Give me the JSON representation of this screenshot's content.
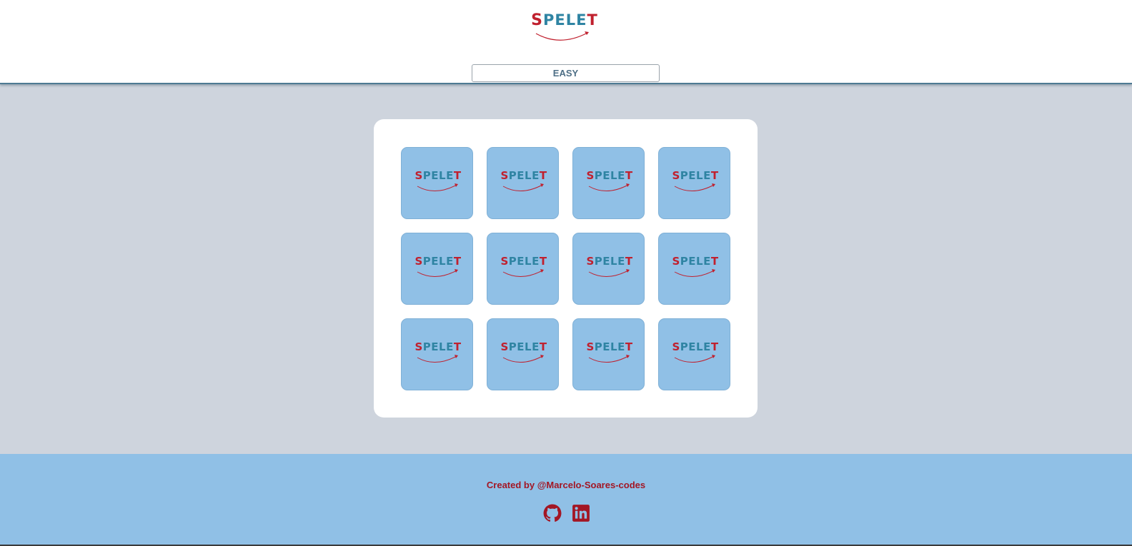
{
  "header": {
    "logo": {
      "letters": [
        "S",
        "P",
        "E",
        "L",
        "E",
        "T"
      ],
      "icon": "spelet-logo"
    },
    "difficulty_label": "EASY"
  },
  "board": {
    "card_back_icon": "spelet-logo",
    "rows": 3,
    "columns": 4,
    "cards": [
      {
        "id": "card-1"
      },
      {
        "id": "card-2"
      },
      {
        "id": "card-3"
      },
      {
        "id": "card-4"
      },
      {
        "id": "card-5"
      },
      {
        "id": "card-6"
      },
      {
        "id": "card-7"
      },
      {
        "id": "card-8"
      },
      {
        "id": "card-9"
      },
      {
        "id": "card-10"
      },
      {
        "id": "card-11"
      },
      {
        "id": "card-12"
      }
    ]
  },
  "footer": {
    "credit": "Created by @Marcelo-Soares-codes",
    "social_icons": [
      "github-icon",
      "linkedin-icon"
    ]
  },
  "colors": {
    "page_background": "#ced4dd",
    "card_back": "#90c0e6",
    "brand_red": "#c0202e",
    "brand_teal": "#2f84a3",
    "footer_background": "#90c0e6"
  }
}
